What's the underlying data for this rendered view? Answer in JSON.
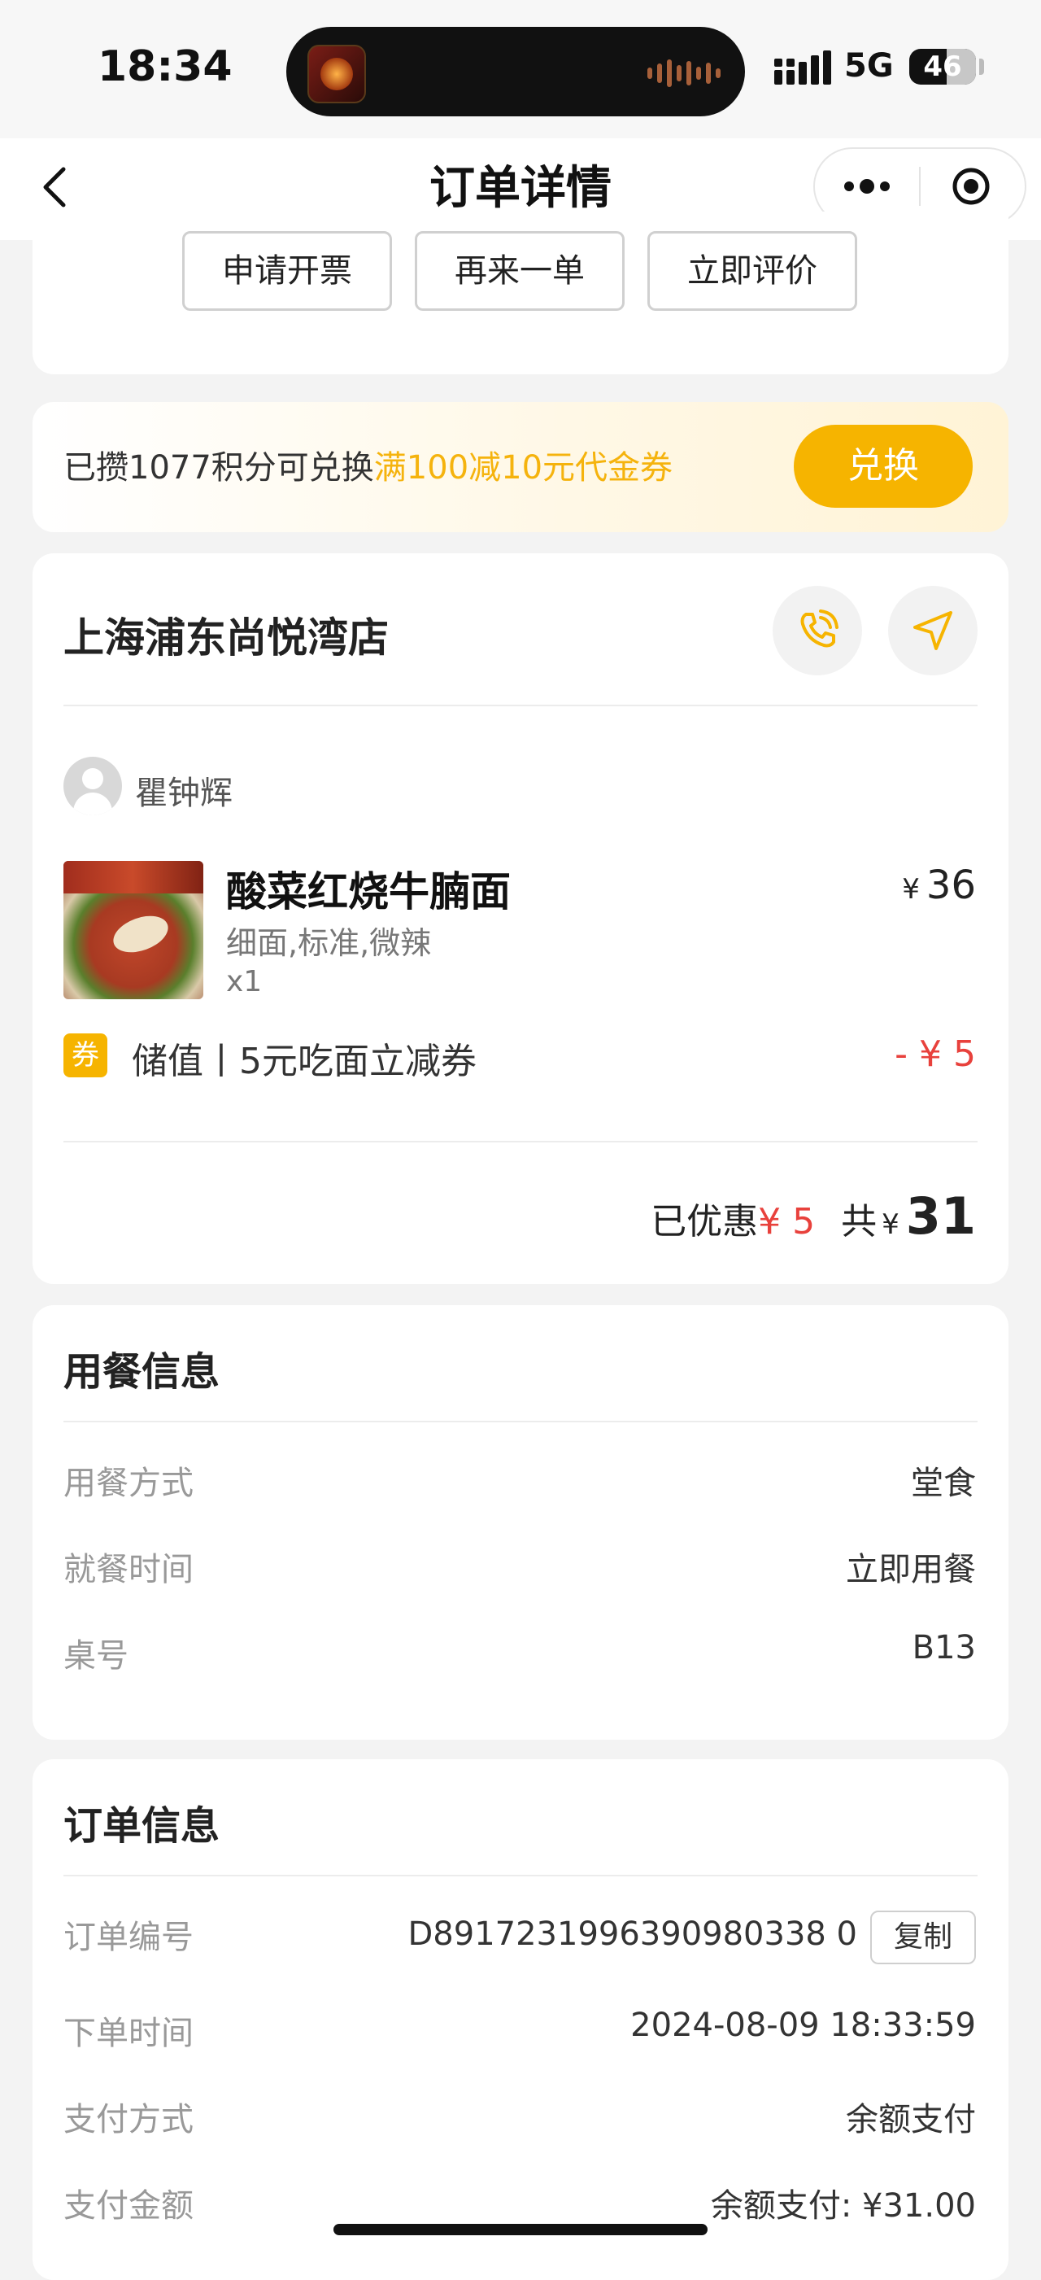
{
  "status_bar": {
    "time": "18:34",
    "network": "5G",
    "battery": "46"
  },
  "nav": {
    "title": "订单详情",
    "back_icon": "chevron-left-icon",
    "more_icon": "more-dots-icon",
    "target_icon": "target-icon"
  },
  "actions": {
    "invoice": "申请开票",
    "reorder": "再来一单",
    "review": "立即评价"
  },
  "promo": {
    "prefix": "已攒1077积分可兑换",
    "highlight": "满100减10元代金券",
    "button": "兑换",
    "accent": "#f6b400"
  },
  "store": {
    "name": "上海浦东尚悦湾店",
    "phone_icon": "phone-icon",
    "nav_icon": "navigation-arrow-icon"
  },
  "order_user": {
    "name": "瞿钟辉"
  },
  "item": {
    "name": "酸菜红烧牛腩面",
    "spec": "细面,标准,微辣",
    "qty": "x1",
    "currency": "¥",
    "price": "36"
  },
  "coupon": {
    "badge": "券",
    "text": "储值丨5元吃面立减券",
    "amount": "- ¥ 5"
  },
  "summary": {
    "discount_label": "已优惠",
    "discount_value": "¥ 5",
    "total_label": "共",
    "currency": "¥",
    "total": "31"
  },
  "dining": {
    "title": "用餐信息",
    "rows": [
      {
        "label": "用餐方式",
        "value": "堂食"
      },
      {
        "label": "就餐时间",
        "value": "立即用餐"
      },
      {
        "label": "桌号",
        "value": "B13"
      }
    ]
  },
  "order_info": {
    "title": "订单信息",
    "copy_label": "复制",
    "rows": [
      {
        "label": "订单编号",
        "value": "D8917231996390980338 0"
      },
      {
        "label": "下单时间",
        "value": "2024-08-09 18:33:59"
      },
      {
        "label": "支付方式",
        "value": "余额支付"
      },
      {
        "label": "支付金额",
        "value": "余额支付: ¥31.00"
      }
    ]
  },
  "colors": {
    "accent": "#f6b400",
    "price_red": "#e8413c"
  }
}
